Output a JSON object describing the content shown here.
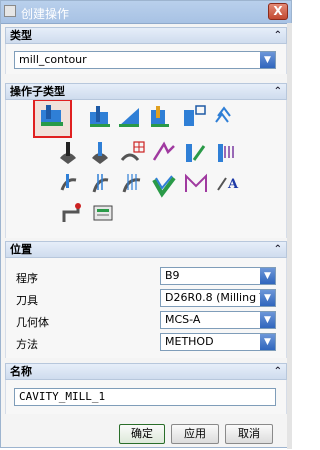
{
  "window": {
    "title": "创建操作",
    "close_glyph": "X"
  },
  "type_section": {
    "header": "类型",
    "value": "mill_contour"
  },
  "subtype_section": {
    "header": "操作子类型",
    "icons": [
      "cavity-mill-icon",
      "plunge-mill-icon",
      "corner-rough-icon",
      "rest-mill-icon",
      "zlevel-profile-icon",
      "zlevel-corner-icon",
      "fixed-contour-icon",
      "contour-area-icon",
      "contour-surface-area-icon",
      "streamline-icon",
      "contour-area-non-steep-icon",
      "contour-area-dir-steep-icon",
      "flowcut-single-icon",
      "flowcut-multiple-icon",
      "flowcut-ref-tool-icon",
      "flowcut-smooth-icon",
      "profile-3d-icon",
      "contour-text-icon",
      "mill-user-icon",
      "mill-control-icon"
    ]
  },
  "location_section": {
    "header": "位置",
    "rows": [
      {
        "label": "程序",
        "value": "B9"
      },
      {
        "label": "刀具",
        "value": "D26R0.8 (Milling T"
      },
      {
        "label": "几何体",
        "value": "MCS-A"
      },
      {
        "label": "方法",
        "value": "METHOD"
      }
    ]
  },
  "name_section": {
    "header": "名称",
    "value": "CAVITY_MILL_1"
  },
  "buttons": {
    "ok": "确定",
    "apply": "应用",
    "cancel": "取消"
  },
  "icons": {
    "collapse": "chevron-up-icon",
    "dropdown": "chevron-down-icon"
  },
  "colors": {
    "titlebar": "#a8c2e4",
    "selection": "#e02020"
  }
}
